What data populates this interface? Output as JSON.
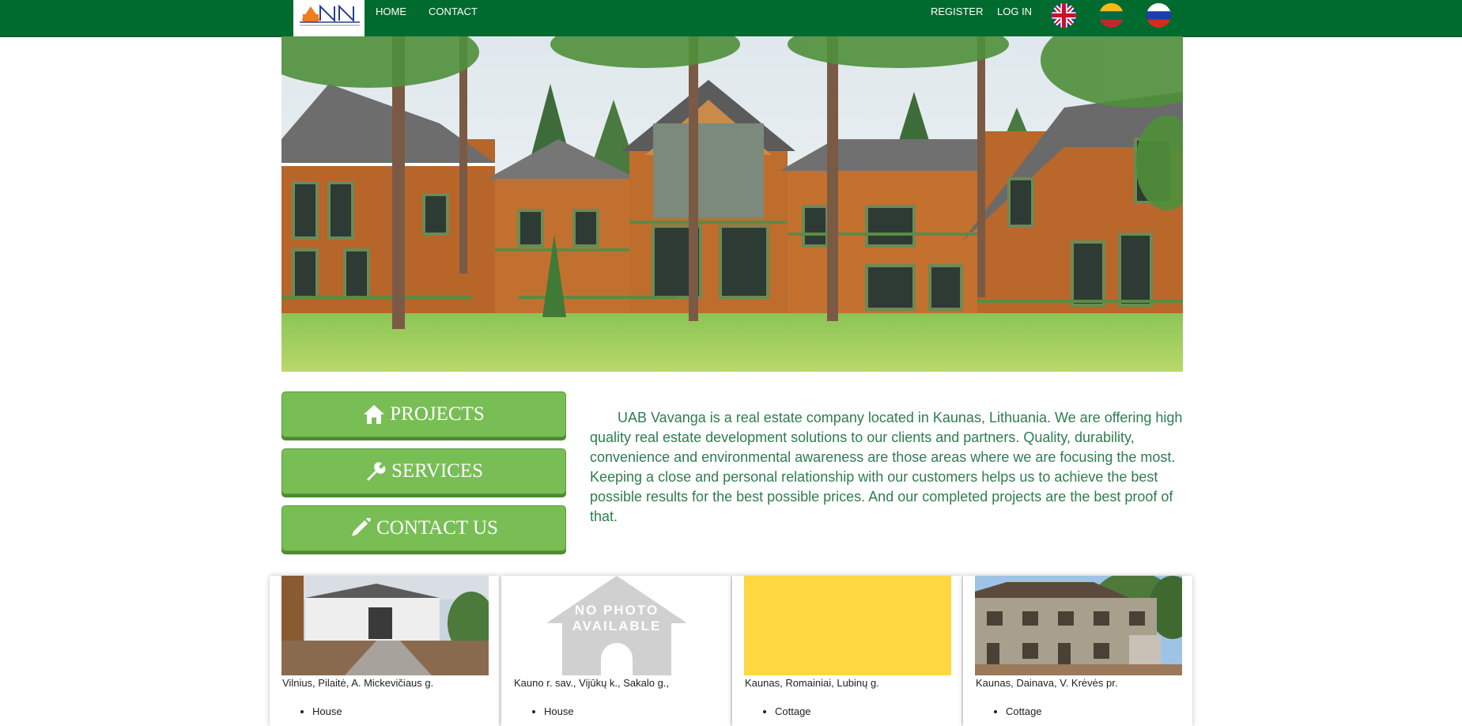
{
  "header": {
    "logo_alt": "Vavanga logo",
    "nav": [
      {
        "label": "HOME"
      },
      {
        "label": "CONTACT"
      }
    ],
    "register_label": "REGISTER",
    "login_label": "LOG IN",
    "languages": [
      "English",
      "Lithuanian",
      "Russian"
    ],
    "colors": {
      "bar": "#006b2f",
      "text": "#ffffff"
    }
  },
  "hero": {
    "alt": "Wooden houses among pine trees"
  },
  "buttons": [
    {
      "label": "PROJECTS",
      "icon": "home-icon"
    },
    {
      "label": "SERVICES",
      "icon": "wrench-icon"
    },
    {
      "label": "CONTACT US",
      "icon": "pencil-icon"
    }
  ],
  "intro": "UAB Vavanga is a real estate company located in Kaunas, Lithuania. We are offering high quality real estate development solutions to our clients and partners. Quality, durability, convenience and environmental awareness are those areas where we are focusing the most. Keeping a close and personal relationship with our customers helps us to achieve the best possible results for the best possible prices. And our completed projects are the best proof of that.",
  "projects": [
    {
      "location": "Vilnius, Pilaitė, A. Mickevičiaus g.",
      "type": "House"
    },
    {
      "location": "Kauno r. sav., Vijūkų k., Sakalo g.,",
      "type": "House",
      "placeholder_line1": "NO PHOTO",
      "placeholder_line2": "AVAILABLE"
    },
    {
      "location": "Kaunas, Romainiai, Lubinų g.",
      "type": "Cottage"
    },
    {
      "location": "Kaunas, Dainava, V. Krėvės pr.",
      "type": "Cottage"
    }
  ],
  "colors": {
    "button": "#78be55",
    "intro_text": "#2e7d4f",
    "placeholder_yellow": "#ffd740"
  }
}
